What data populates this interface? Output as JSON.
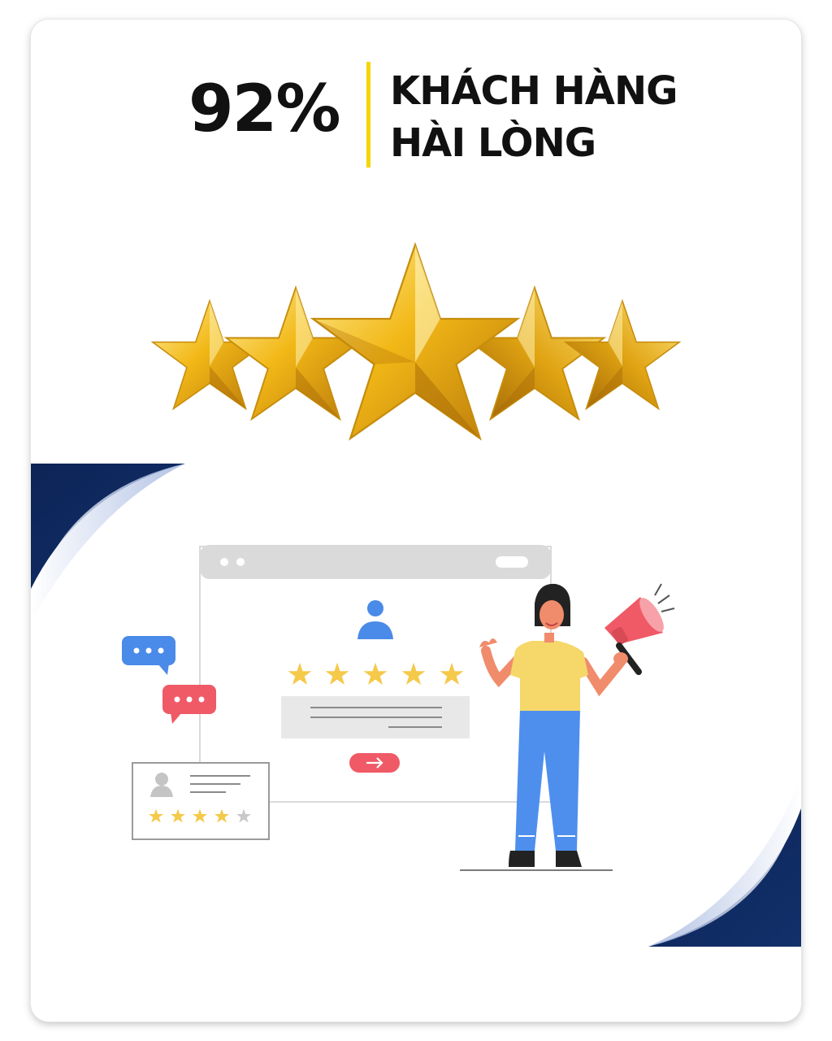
{
  "headline": {
    "value": "92%",
    "line1": "KHÁCH HÀNG",
    "line2": "HÀI LÒNG"
  },
  "colors": {
    "accent_bar": "#f4d600",
    "navy": "#0d2456",
    "star_gold": "#f2b817",
    "chat_blue": "#4a8ae8",
    "chat_red": "#ef5a66",
    "shirt": "#f5d76a",
    "pants": "#4e8fee"
  },
  "rating": {
    "big_stars": 5,
    "review_stars_filled": 5,
    "small_card_stars_filled": 4,
    "small_card_stars_total": 5
  },
  "icons": [
    "star-icon",
    "chat-bubble-icon",
    "megaphone-icon",
    "user-icon",
    "arrow-right-icon"
  ]
}
